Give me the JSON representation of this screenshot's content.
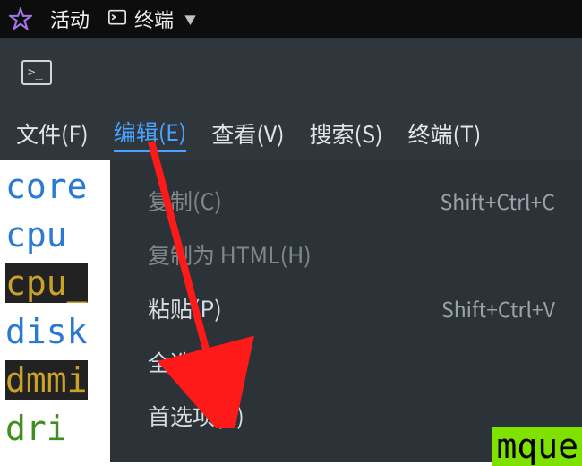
{
  "topbar": {
    "activities": "活动",
    "app_name": "终端"
  },
  "menubar": {
    "file": "文件(F)",
    "edit": "编辑(E)",
    "view": "查看(V)",
    "search": "搜索(S)",
    "term": "终端(T)"
  },
  "edit_menu": {
    "copy": {
      "label": "复制(C)",
      "short": "Shift+Ctrl+C"
    },
    "copy_html": {
      "label": "复制为 HTML(H)",
      "short": ""
    },
    "paste": {
      "label": "粘贴(P)",
      "short": "Shift+Ctrl+V"
    },
    "select_all": {
      "label": "全选(A)",
      "short": ""
    },
    "prefs": {
      "label": "首选项(R)",
      "short": ""
    }
  },
  "term_lines": {
    "l0": "core",
    "l1": "cpu",
    "l2": "cpu_",
    "l3": "disk",
    "l4": "dmmi",
    "l5": "dri"
  },
  "frag_right": "mque"
}
